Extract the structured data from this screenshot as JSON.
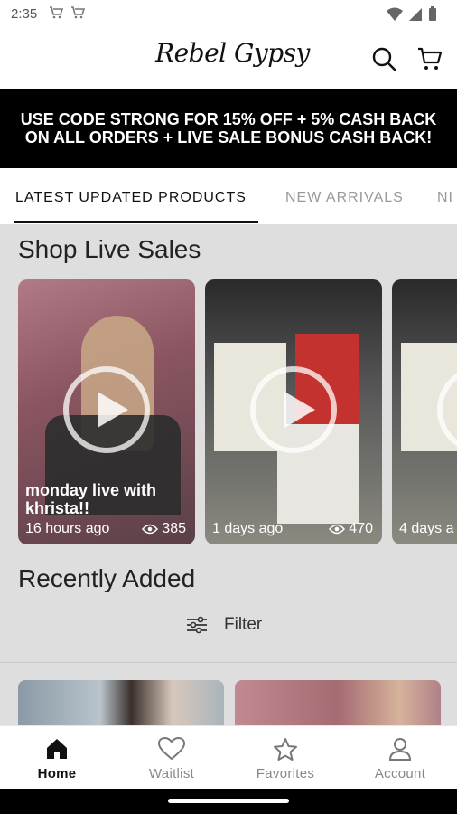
{
  "status_bar": {
    "time": "2:35"
  },
  "header": {
    "logo_text": "Rebel Gypsy"
  },
  "promo": {
    "text": "USE CODE STRONG FOR 15% OFF + 5% CASH BACK ON ALL ORDERS + LIVE SALE BONUS CASH BACK!"
  },
  "tabs": [
    {
      "label": "LATEST UPDATED PRODUCTS"
    },
    {
      "label": "NEW ARRIVALS"
    },
    {
      "label": "NI"
    }
  ],
  "live_sales": {
    "title": "Shop Live Sales",
    "cards": [
      {
        "title": "monday live with khrista!!",
        "ago": "16 hours ago",
        "views": "385"
      },
      {
        "title": "",
        "ago": "1 days ago",
        "views": "470"
      },
      {
        "title": "",
        "ago": "4 days a",
        "views": ""
      }
    ]
  },
  "recent": {
    "title": "Recently Added",
    "filter_label": "Filter"
  },
  "bottom_nav": [
    {
      "label": "Home",
      "icon": "home-icon"
    },
    {
      "label": "Waitlist",
      "icon": "heart-icon"
    },
    {
      "label": "Favorites",
      "icon": "star-icon"
    },
    {
      "label": "Account",
      "icon": "person-icon"
    }
  ],
  "colors": {
    "accent": "#000000",
    "background": "#dedede",
    "inactive": "#999999"
  }
}
